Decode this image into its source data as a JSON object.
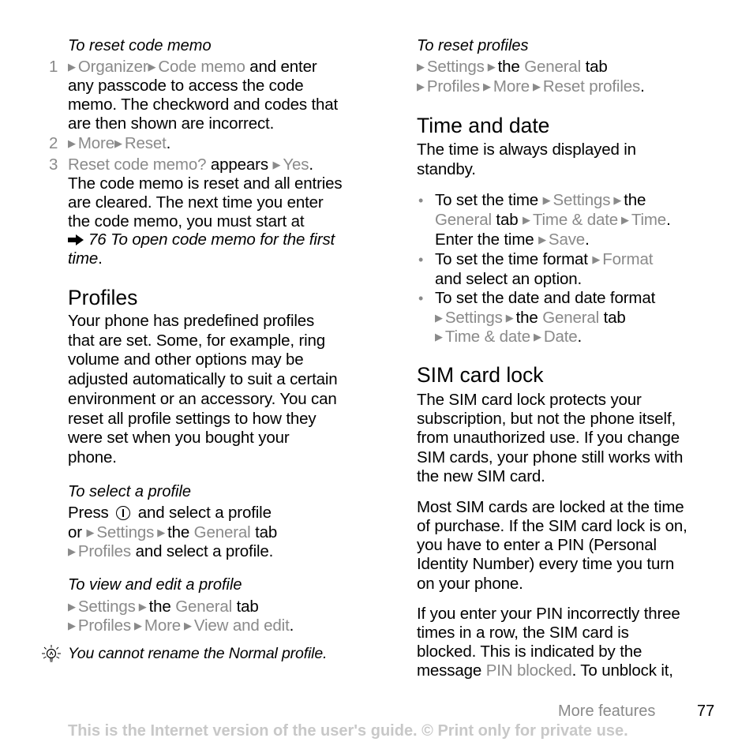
{
  "left_column": {
    "reset_code_memo": {
      "heading": "To reset code memo",
      "steps": [
        {
          "number": "1",
          "lines": [
            [
              {
                "arrow": true
              },
              {
                "t": "Organizer",
                "g": true
              },
              {
                "arrow": true
              },
              {
                "t": "Code memo",
                "g": true
              },
              {
                "t": " and enter"
              }
            ],
            [
              {
                "t": "any passcode to access the code"
              }
            ],
            [
              {
                "t": "memo. The checkword and codes that"
              }
            ],
            [
              {
                "t": "are then shown are incorrect."
              }
            ]
          ]
        },
        {
          "number": "2",
          "lines": [
            [
              {
                "arrow": true
              },
              {
                "t": "More",
                "g": true
              },
              {
                "arrow": true
              },
              {
                "t": "Reset",
                "g": true
              },
              {
                "t": "."
              }
            ]
          ]
        },
        {
          "number": "3",
          "lines": [
            [
              {
                "t": "Reset code memo?",
                "g": true
              },
              {
                "t": " appears "
              },
              {
                "arrow": true
              },
              {
                "t": "Yes",
                "g": true
              },
              {
                "t": "."
              }
            ],
            [
              {
                "t": "The code memo is reset and all entries"
              }
            ],
            [
              {
                "t": "are cleared. The next time you enter"
              }
            ],
            [
              {
                "t": "the code memo, you must start at"
              }
            ]
          ]
        }
      ],
      "cross_reference": {
        "icon": "arrow-right-icon",
        "page": "76",
        "text_line1": "To open code memo for the first",
        "text_line2": "time",
        "trailing": "."
      }
    },
    "profiles": {
      "heading": "Profiles",
      "body_lines": [
        "Your phone has predefined profiles",
        "that are set. Some, for example, ring",
        "volume and other options may be",
        "adjusted automatically to suit a certain",
        "environment or an accessory. You can",
        "reset all profile settings to how they",
        "were set when you bought your",
        "phone."
      ]
    },
    "select_profile": {
      "heading": "To select a profile",
      "lines": [
        [
          {
            "t": "Press "
          },
          {
            "key": "power-key-icon"
          },
          {
            "t": " and select a profile"
          }
        ],
        [
          {
            "t": "or "
          },
          {
            "arrow": true
          },
          {
            "t": "Settings",
            "g": true
          },
          {
            "arrow": true,
            "pre": true
          },
          {
            "t": "the "
          },
          {
            "t": "General",
            "g": true
          },
          {
            "t": " tab"
          }
        ],
        [
          {
            "arrow": true
          },
          {
            "t": "Profiles",
            "g": true
          },
          {
            "t": " and select a profile."
          }
        ]
      ]
    },
    "view_edit_profile": {
      "heading": "To view and edit a profile",
      "lines": [
        [
          {
            "arrow": true
          },
          {
            "t": "Settings",
            "g": true
          },
          {
            "arrow": true,
            "pre": true
          },
          {
            "t": "the "
          },
          {
            "t": "General",
            "g": true
          },
          {
            "t": " tab"
          }
        ],
        [
          {
            "arrow": true
          },
          {
            "t": "Profiles",
            "g": true
          },
          {
            "arrow": true,
            "pre": true
          },
          {
            "t": "More",
            "g": true
          },
          {
            "arrow": true,
            "pre": true
          },
          {
            "t": "View and edit",
            "g": true
          },
          {
            "t": "."
          }
        ]
      ]
    },
    "tip": {
      "icon": "lightbulb-icon",
      "text": "You cannot rename the Normal profile."
    }
  },
  "right_column": {
    "reset_profiles": {
      "heading": "To reset profiles",
      "lines": [
        [
          {
            "arrow": true
          },
          {
            "t": "Settings",
            "g": true
          },
          {
            "arrow": true,
            "pre": true
          },
          {
            "t": "the "
          },
          {
            "t": "General",
            "g": true
          },
          {
            "t": " tab"
          }
        ],
        [
          {
            "arrow": true
          },
          {
            "t": "Profiles",
            "g": true
          },
          {
            "arrow": true,
            "pre": true
          },
          {
            "t": "More",
            "g": true
          },
          {
            "arrow": true,
            "pre": true
          },
          {
            "t": "Reset profiles",
            "g": true
          },
          {
            "t": "."
          }
        ]
      ]
    },
    "time_and_date": {
      "heading": "Time and date",
      "intro_lines": [
        "The time is always displayed in",
        "standby."
      ],
      "bullets": [
        {
          "lines": [
            [
              {
                "t": "To set the time "
              },
              {
                "arrow": true
              },
              {
                "t": "Settings",
                "g": true
              },
              {
                "arrow": true,
                "pre": true
              },
              {
                "t": "the"
              }
            ],
            [
              {
                "t": "General",
                "g": true
              },
              {
                "t": " tab "
              },
              {
                "arrow": true
              },
              {
                "t": "Time & date",
                "g": true
              },
              {
                "arrow": true,
                "pre": true
              },
              {
                "t": "Time",
                "g": true
              },
              {
                "t": "."
              }
            ],
            [
              {
                "t": "Enter the time "
              },
              {
                "arrow": true
              },
              {
                "t": "Save",
                "g": true
              },
              {
                "t": "."
              }
            ]
          ]
        },
        {
          "lines": [
            [
              {
                "t": "To set the time format "
              },
              {
                "arrow": true
              },
              {
                "t": "Format",
                "g": true
              }
            ],
            [
              {
                "t": "and select an option."
              }
            ]
          ]
        },
        {
          "lines": [
            [
              {
                "t": "To set the date and date format"
              }
            ],
            [
              {
                "arrow": true
              },
              {
                "t": "Settings",
                "g": true
              },
              {
                "arrow": true,
                "pre": true
              },
              {
                "t": "the "
              },
              {
                "t": "General",
                "g": true
              },
              {
                "t": " tab"
              }
            ],
            [
              {
                "arrow": true
              },
              {
                "t": "Time & date",
                "g": true
              },
              {
                "arrow": true,
                "pre": true
              },
              {
                "t": "Date",
                "g": true
              },
              {
                "t": "."
              }
            ]
          ]
        }
      ]
    },
    "sim_card_lock": {
      "heading": "SIM card lock",
      "paragraphs": [
        [
          [
            {
              "t": "The SIM card lock protects your"
            }
          ],
          [
            {
              "t": "subscription, but not the phone itself,"
            }
          ],
          [
            {
              "t": "from unauthorized use. If you change"
            }
          ],
          [
            {
              "t": "SIM cards, your phone still works with"
            }
          ],
          [
            {
              "t": "the new SIM card."
            }
          ]
        ],
        [
          [
            {
              "t": "Most SIM cards are locked at the time"
            }
          ],
          [
            {
              "t": "of purchase. If the SIM card lock is on,"
            }
          ],
          [
            {
              "t": "you have to enter a PIN (Personal"
            }
          ],
          [
            {
              "t": "Identity Number) every time you turn"
            }
          ],
          [
            {
              "t": "on your phone."
            }
          ]
        ],
        [
          [
            {
              "t": "If you enter your PIN incorrectly three"
            }
          ],
          [
            {
              "t": "times in a row, the SIM card is"
            }
          ],
          [
            {
              "t": "blocked. This is indicated by the"
            }
          ],
          [
            {
              "t": "message "
            },
            {
              "t": "PIN blocked",
              "g": true
            },
            {
              "t": ". To unblock it,"
            }
          ]
        ]
      ]
    }
  },
  "footer": {
    "section": "More features",
    "page_number": "77",
    "notice": "This is the Internet version of the user's guide. © Print only for private use."
  },
  "colors": {
    "text": "#000000",
    "menu_path_gray": "#8a8a8a",
    "notice_gray": "#c8c8c8"
  }
}
